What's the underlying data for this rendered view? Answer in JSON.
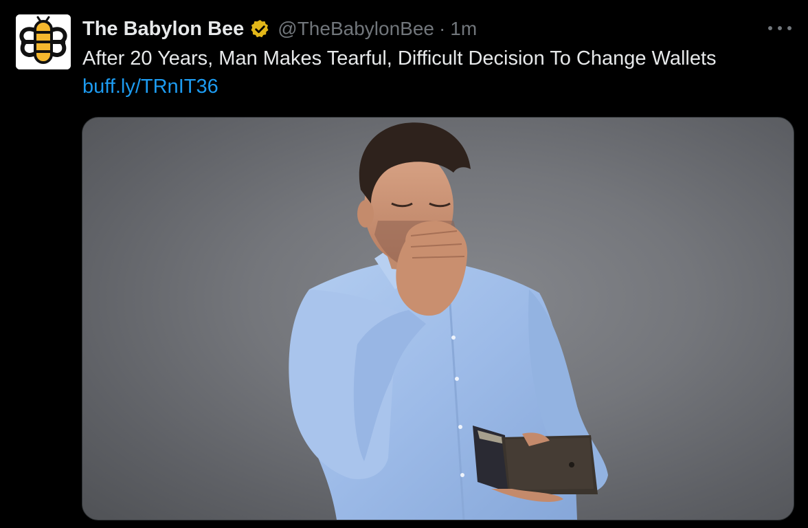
{
  "tweet": {
    "display_name": "The Babylon Bee",
    "handle": "@TheBabylonBee",
    "separator": "·",
    "timestamp": "1m",
    "text": "After 20 Years, Man Makes Tearful, Difficult Decision To Change Wallets",
    "link": "buff.ly/TRnIT36",
    "verified_badge": "gold-verified-icon",
    "more_options_icon": "more-horizontal-icon"
  },
  "media": {
    "type": "photo",
    "subject": "man-holding-open-wallet"
  },
  "colors": {
    "background": "#000000",
    "text_primary": "#e7e9ea",
    "text_secondary": "#71767b",
    "link": "#1d9bf0",
    "verified_gold": "#e2b719",
    "bee_yellow": "#f5b82e"
  }
}
